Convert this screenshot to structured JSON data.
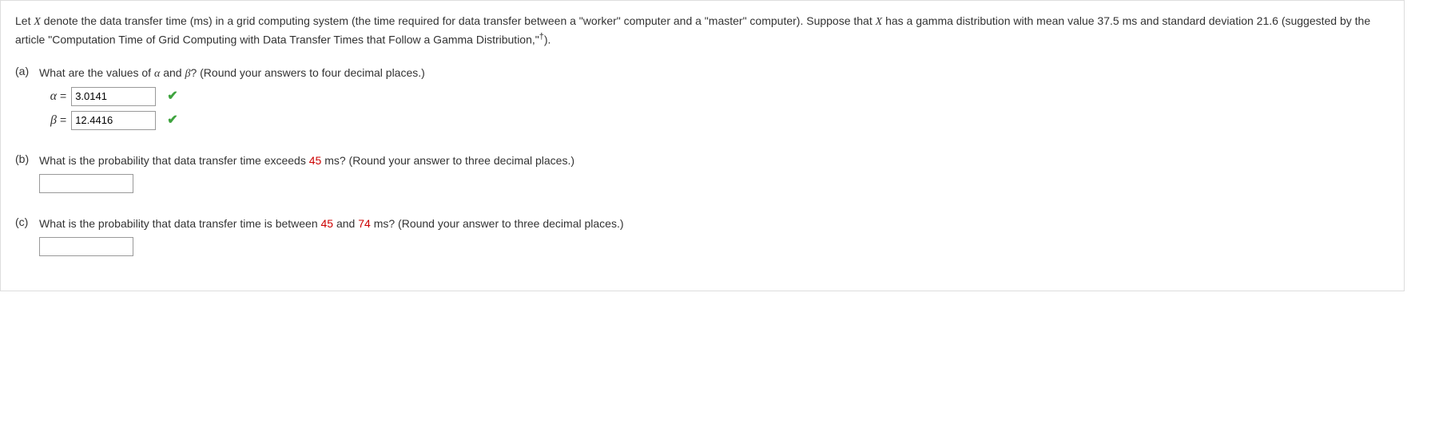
{
  "problem": {
    "line1_a": "Let ",
    "line1_var": "X",
    "line1_b": " denote the data transfer time (ms) in a grid computing system (the time required for data transfer between a \"worker\" computer and a \"master\" computer). Suppose that ",
    "line1_var2": "X",
    "line1_c": " has a gamma distribution with mean value 37.5 ms and standard deviation 21.6 (suggested by the article \"Computation Time of Grid Computing with Data Transfer Times that Follow a Gamma Distribution,\"",
    "dagger": "†",
    "line1_d": ")."
  },
  "partA": {
    "label": "(a)",
    "question_a": "What are the values of ",
    "alpha": "α",
    "question_b": " and ",
    "beta": "β",
    "question_c": "? (Round your answers to four decimal places.)",
    "alpha_sym": "α",
    "alpha_eq": "=",
    "alpha_val": "3.0141",
    "beta_sym": "β",
    "beta_eq": "=",
    "beta_val": "12.4416"
  },
  "partB": {
    "label": "(b)",
    "question_a": "What is the probability that data transfer time exceeds ",
    "value45": "45",
    "question_b": " ms? (Round your answer to three decimal places.)",
    "answer": ""
  },
  "partC": {
    "label": "(c)",
    "question_a": "What is the probability that data transfer time is between ",
    "value45": "45",
    "question_b": " and ",
    "value74": "74",
    "question_c": " ms? (Round your answer to three decimal places.)",
    "answer": ""
  },
  "checkGlyph": "✔"
}
